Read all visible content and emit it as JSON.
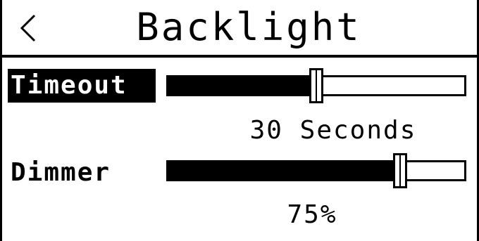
{
  "header": {
    "back_glyph": "<",
    "title": "Backlight"
  },
  "settings": {
    "timeout": {
      "label": "Timeout",
      "value_text": "30 Seconds",
      "level": 0.5,
      "selected": true
    },
    "dimmer": {
      "label": "Dimmer",
      "value_text": "75%",
      "level": 0.78,
      "selected": false
    }
  },
  "colors": {
    "foreground": "#000000",
    "background": "#ffffff"
  }
}
